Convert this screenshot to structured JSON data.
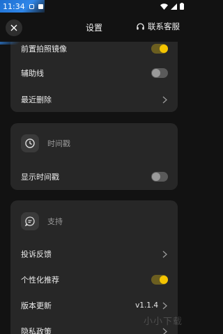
{
  "status_bar": {
    "time": "11:34",
    "icons": [
      "notification-a-icon",
      "notification-b-icon",
      "wifi-icon",
      "signal-icon",
      "battery-icon"
    ]
  },
  "header": {
    "title": "设置",
    "contact_label": "联系客服"
  },
  "camera_section": {
    "items": [
      {
        "label": "前置拍照镜像",
        "toggle": "on"
      },
      {
        "label": "辅助线",
        "toggle": "off"
      },
      {
        "label": "最近删除",
        "chevron": true
      }
    ]
  },
  "timestamp_section": {
    "title": "时间戳",
    "items": [
      {
        "label": "显示时间戳",
        "toggle": "off"
      }
    ]
  },
  "support_section": {
    "title": "支持",
    "items": [
      {
        "label": "投诉反馈",
        "chevron": true
      },
      {
        "label": "个性化推荐",
        "toggle": "on"
      },
      {
        "label": "版本更新",
        "value": "v1.1.4",
        "chevron": true
      },
      {
        "label": "隐私政策",
        "chevron": true
      }
    ]
  },
  "colors": {
    "background": "#121212",
    "card": "#272727",
    "toggle_on": "#f4c400",
    "accent_corner": "#2f86e8"
  },
  "watermark": "小小下载"
}
